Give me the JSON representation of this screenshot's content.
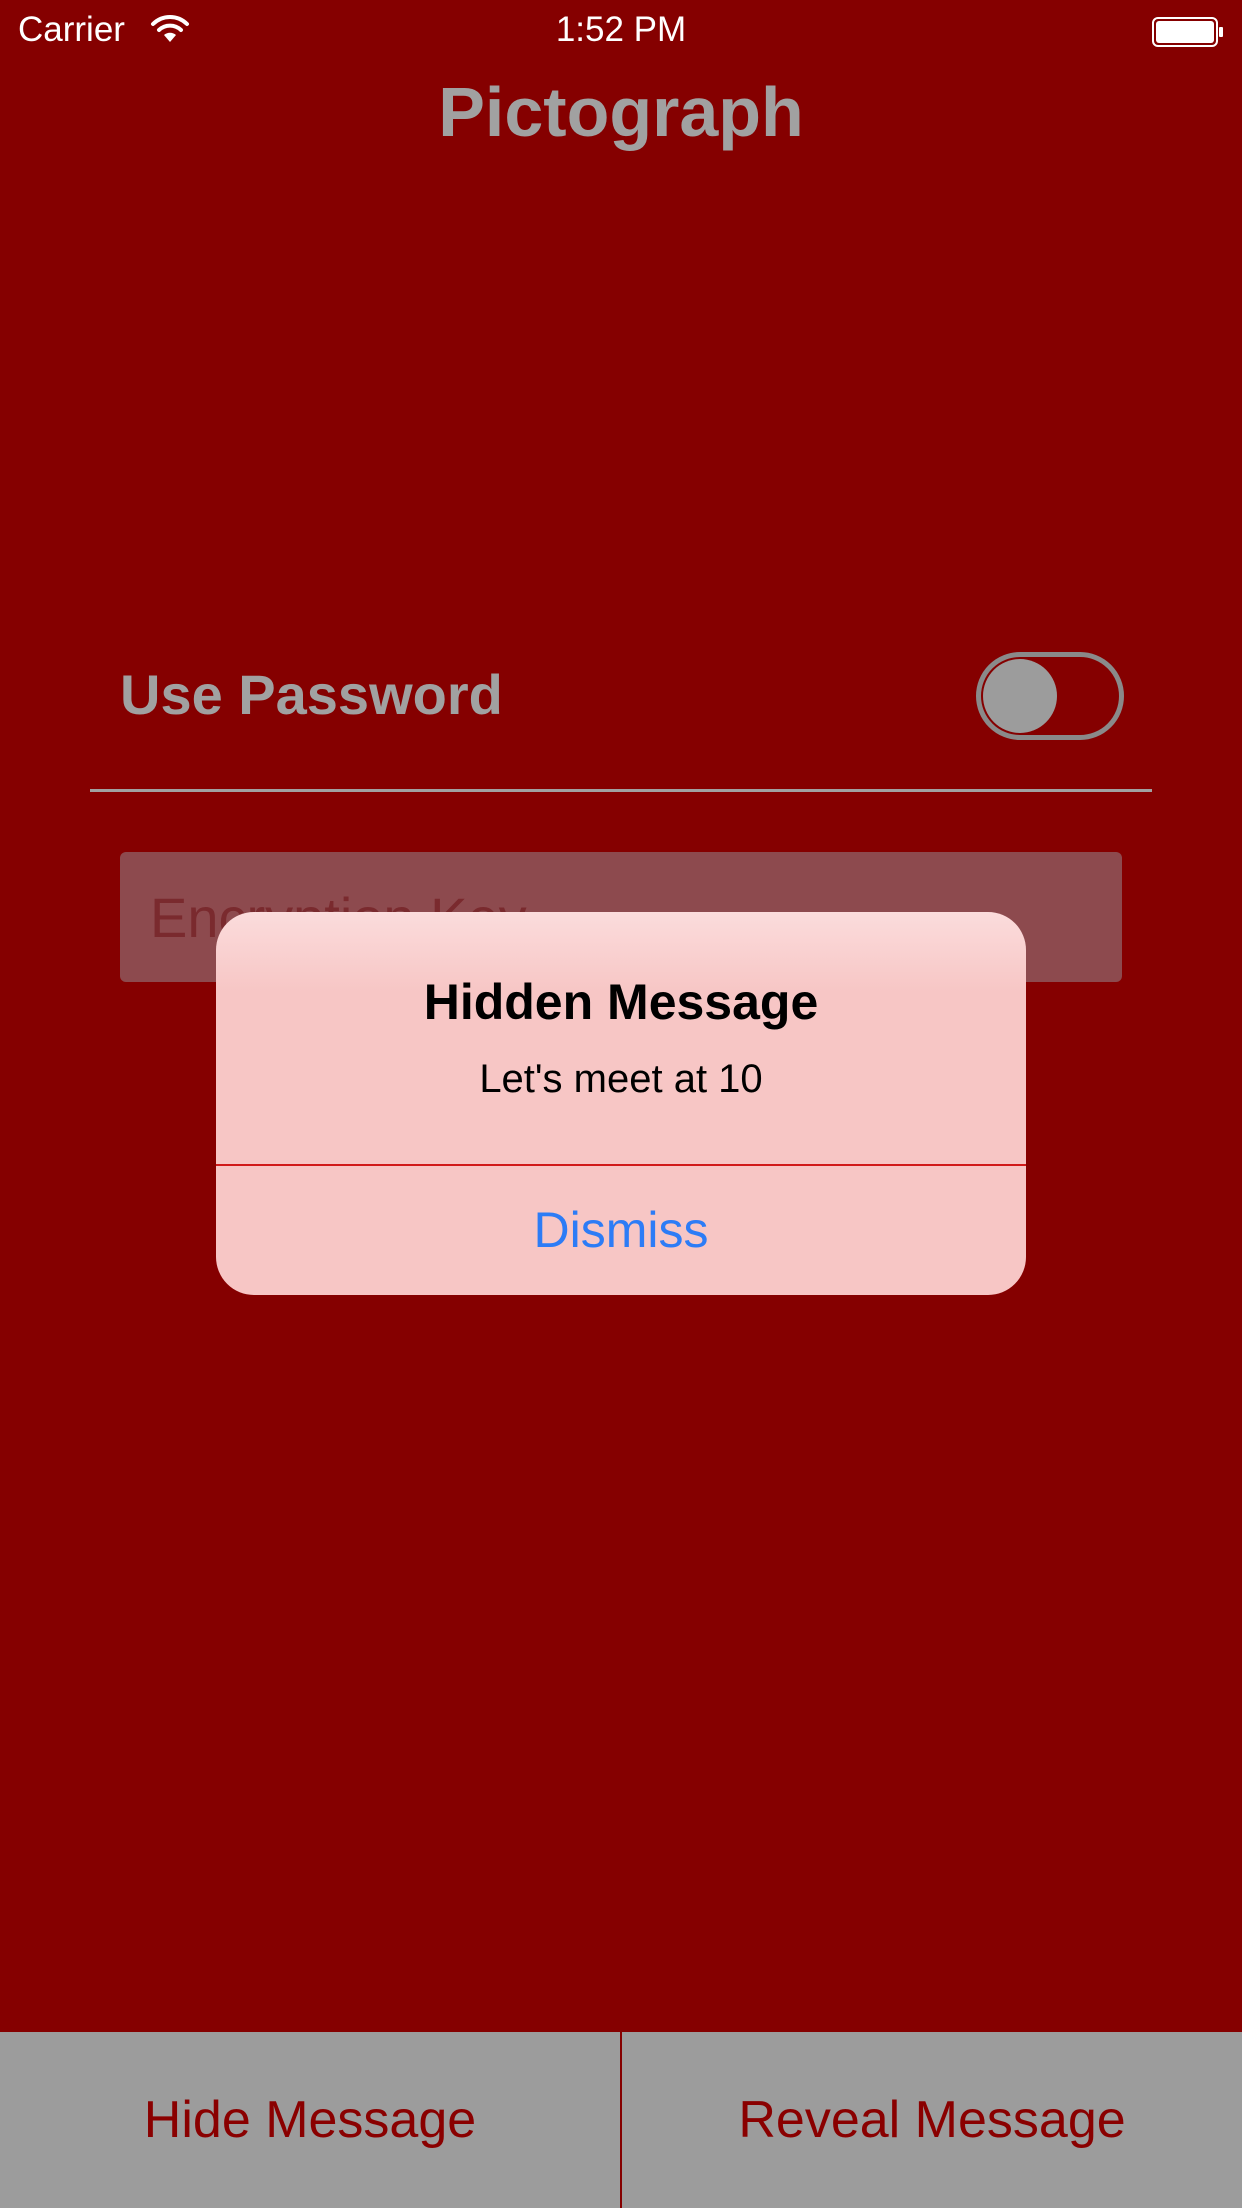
{
  "status_bar": {
    "carrier": "Carrier",
    "time": "1:52 PM",
    "wifi_icon": "wifi-icon",
    "battery_icon": "battery-icon"
  },
  "app": {
    "title": "Pictograph"
  },
  "password": {
    "label": "Use Password",
    "toggle_on": false
  },
  "encryption": {
    "placeholder": "Encryption Key",
    "value": ""
  },
  "alert": {
    "title": "Hidden Message",
    "message": "Let's meet at 10",
    "dismiss_label": "Dismiss"
  },
  "bottom_bar": {
    "hide_label": "Hide Message",
    "reveal_label": "Reveal Message"
  },
  "colors": {
    "background": "#850000",
    "title_gray": "#a1a1a1",
    "alert_background": "#f7c6c5",
    "dismiss_blue": "#2d7cf6",
    "bottom_button_text": "#8a0000",
    "bottom_bar": "#9c9c9c"
  }
}
